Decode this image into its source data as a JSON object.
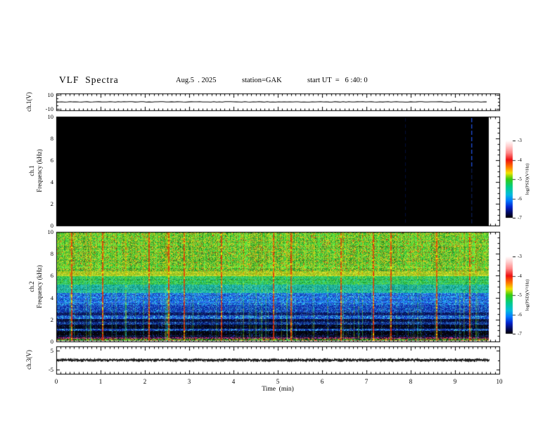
{
  "header": {
    "title": "VLF  Spectra",
    "date": "Aug.5  . 2025",
    "station": "station=GAK",
    "start_ut": "start UT  =   6 :40: 0"
  },
  "x_axis": {
    "label": "Time  (min)",
    "tick_labels": [
      "0",
      "1",
      "2",
      "3",
      "4",
      "5",
      "6",
      "7",
      "8",
      "9",
      "10"
    ],
    "range_min": [
      0,
      10
    ],
    "minor_tick_step_min": 0.1,
    "data_end_min": 9.76
  },
  "colorbar": {
    "label": "log(PSD)(V²/Hz)",
    "tick_labels": [
      "-3",
      "-4",
      "-5",
      "-6",
      "-7"
    ],
    "range": [
      -7,
      -3
    ],
    "gradient_top_to_bottom": [
      {
        "pos": 0.0,
        "color": "#ffffff"
      },
      {
        "pos": 0.07,
        "color": "#ffd0d0"
      },
      {
        "pos": 0.16,
        "color": "#ff8888"
      },
      {
        "pos": 0.25,
        "color": "#ee1111"
      },
      {
        "pos": 0.34,
        "color": "#ff7700"
      },
      {
        "pos": 0.42,
        "color": "#f2e400"
      },
      {
        "pos": 0.5,
        "color": "#33cc11"
      },
      {
        "pos": 0.6,
        "color": "#00cc88"
      },
      {
        "pos": 0.7,
        "color": "#00bbdd"
      },
      {
        "pos": 0.78,
        "color": "#0077ff"
      },
      {
        "pos": 0.86,
        "color": "#0022cc"
      },
      {
        "pos": 0.94,
        "color": "#000855"
      },
      {
        "pos": 1.0,
        "color": "#000000"
      }
    ]
  },
  "chart_data": [
    {
      "type": "line",
      "panel": "ch1-waveform",
      "ylabel": "ch.1(V)",
      "ylim": [
        -12,
        12
      ],
      "yticks": [
        10,
        -10
      ],
      "ytick_labels": [
        "10",
        "-10"
      ],
      "series": [
        {
          "name": "ch.1 voltage",
          "behavior": "flat quiet trace at 0 V from 0 to 9.76 min",
          "value_v": 0
        }
      ]
    },
    {
      "type": "heatmap",
      "panel": "ch1-spectrogram",
      "ylabel_ch": "ch.1",
      "ylabel_freq": "Frequency (kHz)",
      "ylim_khz": [
        0,
        10
      ],
      "ytick_labels": [
        "10",
        "8",
        "6",
        "4",
        "2",
        "0"
      ],
      "description": "power everywhere at/below -7 (black); faint blue dashed vertical interference lines",
      "blue_line_minutes": [
        7.87,
        9.37
      ]
    },
    {
      "type": "heatmap",
      "panel": "ch2-spectrogram",
      "ylabel_ch": "ch.2",
      "ylabel_freq": "Frequency (kHz)",
      "ylim_khz": [
        0,
        10
      ],
      "ytick_labels": [
        "10",
        "8",
        "6",
        "4",
        "2",
        "0"
      ],
      "description": "broadband VLF noise: green/yellow (-5 to -4) above 6 kHz, teal 4.4-6 kHz, blue 2-4.4 kHz, dark navy below 2 kHz, with sferic vertical streaks",
      "bands": [
        {
          "f": [
            0,
            0.18
          ],
          "base": "#145217",
          "spk": [
            "#cc3322",
            "#bbcc22",
            "#33bb44"
          ],
          "p": 0.5,
          "jit": 24
        },
        {
          "f": [
            0.18,
            0.32
          ],
          "base": "#3a1040",
          "spk": [
            "#bb33bb",
            "#cc3344"
          ],
          "p": 0.4,
          "jit": 20
        },
        {
          "f": [
            0.32,
            0.5
          ],
          "base": "#0a0f2e",
          "spk": [
            "#2233aa"
          ],
          "p": 0.1,
          "jit": 12
        },
        {
          "f": [
            0.5,
            0.9
          ],
          "base": "#03040f",
          "spk": [
            "#1133aa"
          ],
          "p": 0.07,
          "jit": 8
        },
        {
          "f": [
            0.9,
            1.05
          ],
          "base": "#1233a8",
          "spk": [
            "#3fbbee"
          ],
          "p": 0.25,
          "jit": 26
        },
        {
          "f": [
            1.05,
            1.45
          ],
          "base": "#04081f",
          "spk": [
            "#1133aa"
          ],
          "p": 0.09,
          "jit": 10
        },
        {
          "f": [
            1.45,
            1.75
          ],
          "base": "#0d2a88",
          "spk": [
            "#3388dd"
          ],
          "p": 0.2,
          "jit": 24
        },
        {
          "f": [
            1.75,
            2.0
          ],
          "base": "#050d3a",
          "spk": [
            "#2244bb"
          ],
          "p": 0.1,
          "jit": 12
        },
        {
          "f": [
            2.0,
            2.3
          ],
          "base": "#1845c8",
          "spk": [
            "#44ccee"
          ],
          "p": 0.28,
          "jit": 28
        },
        {
          "f": [
            2.3,
            2.6
          ],
          "base": "#0a1860",
          "spk": [
            "#2255cc"
          ],
          "p": 0.12,
          "jit": 16
        },
        {
          "f": [
            2.6,
            3.3
          ],
          "base": "#1238b0",
          "spk": [
            "#3388ee",
            "#22aadd"
          ],
          "p": 0.22,
          "jit": 26
        },
        {
          "f": [
            3.3,
            4.4
          ],
          "base": "#2257d8",
          "spk": [
            "#44ccee",
            "#1199ee"
          ],
          "p": 0.33,
          "jit": 30
        },
        {
          "f": [
            4.4,
            5.2
          ],
          "base": "#19a08a",
          "spk": [
            "#3fd4a0",
            "#22bbcc"
          ],
          "p": 0.35,
          "jit": 28
        },
        {
          "f": [
            5.2,
            5.95
          ],
          "base": "#2fbf4f",
          "spk": [
            "#66dd44",
            "#2fcf9f"
          ],
          "p": 0.35,
          "jit": 26
        },
        {
          "f": [
            5.95,
            6.45
          ],
          "base": "#b8d426",
          "spk": [
            "#e0e42a",
            "#7ccc2e"
          ],
          "p": 0.45,
          "jit": 24
        },
        {
          "f": [
            6.45,
            10.01
          ],
          "base": "#3fc139",
          "spk": [
            "#bfdc24",
            "#8ed832",
            "#d8bc20"
          ],
          "p": 0.4,
          "jit": 24
        }
      ],
      "red_dot_prob": 0.025,
      "red_dot_color": "#d83018",
      "streaks": {
        "seed": 1337,
        "count": 170,
        "strong_minutes": [
          0.32,
          1.02,
          2.07,
          2.5,
          2.86,
          3.7,
          4.88,
          5.27,
          6.4,
          7.12,
          7.52,
          8.55,
          9.3
        ],
        "palette_upper": [
          "#e8e000",
          "#ff8800",
          "#ee3300",
          "#aadd00"
        ],
        "palette_lower": [
          "#44dd22",
          "#22ddcc",
          "#cbe622"
        ],
        "strong_palette": [
          "#ee3300",
          "#ff7700",
          "#ffdd00"
        ]
      }
    },
    {
      "type": "line",
      "panel": "ch3-waveform",
      "ylabel": "ch.3(V)",
      "ylim": [
        -7,
        7
      ],
      "yticks": [
        5,
        -5
      ],
      "ytick_labels": [
        "5",
        "-5"
      ],
      "series": [
        {
          "name": "ch.3 voltage",
          "behavior": "dense noisy band centered at 0 V, ~±0.5 V, from 0 to 9.76 min",
          "value_v": 0
        }
      ]
    }
  ]
}
